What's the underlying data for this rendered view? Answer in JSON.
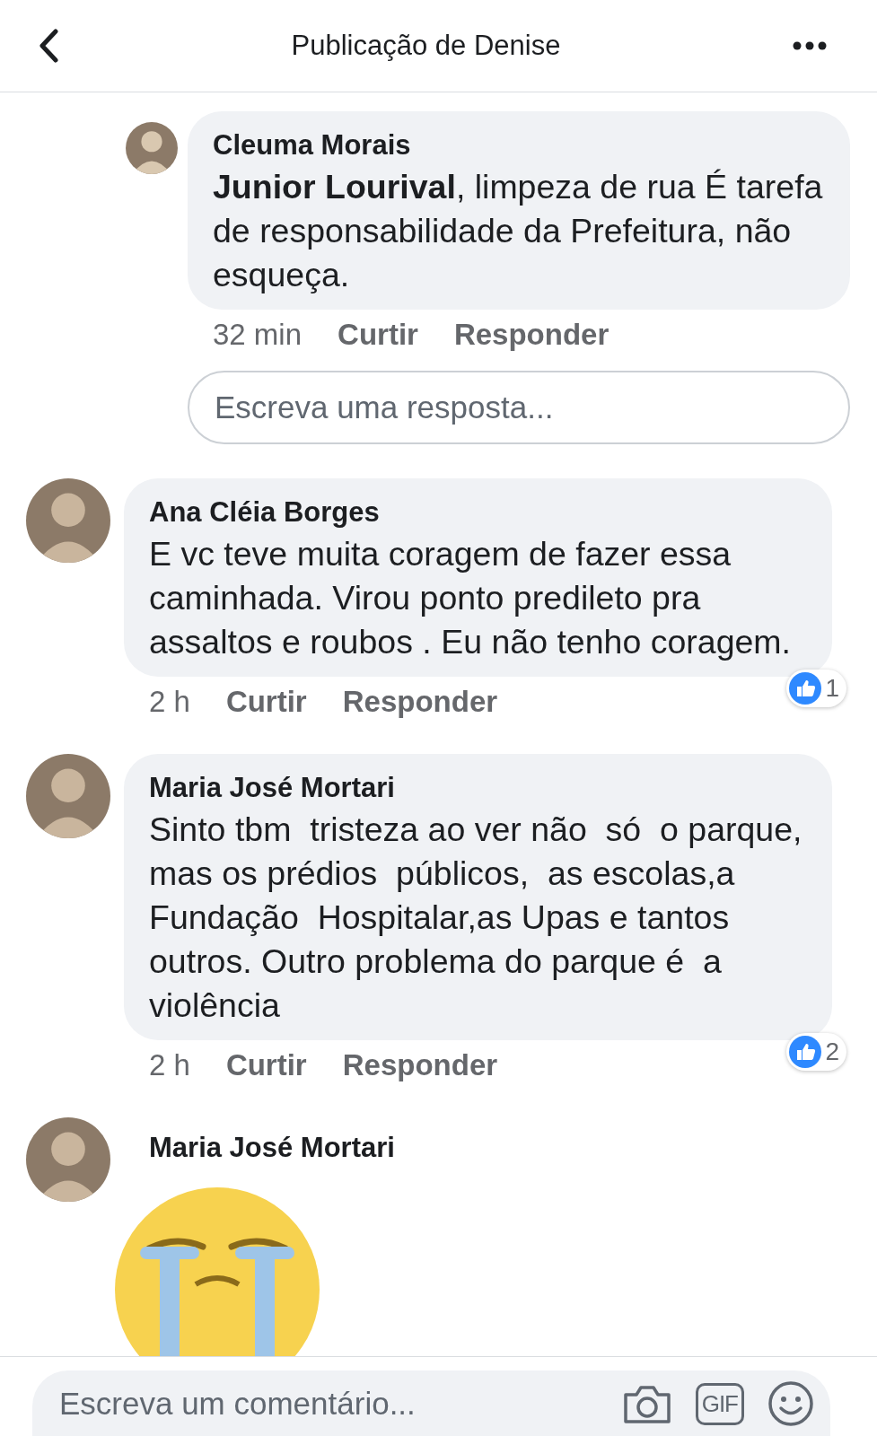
{
  "header": {
    "title": "Publicação de Denise"
  },
  "reply_thread": {
    "replies": [
      {
        "name": "Cleuma Morais",
        "text": "**Junior Lourival**, limpeza de rua É tarefa de responsabilidade da Prefeitura, não esqueça.",
        "time": "32 min",
        "like": "Curtir",
        "reply": "Responder"
      }
    ],
    "reply_field": {
      "placeholder": "Escreva uma resposta..."
    }
  },
  "comments": [
    {
      "kind": "text",
      "name": "Ana Cléia Borges",
      "text": "E vc teve muita coragem de fazer essa caminhada. Virou ponto predileto pra assaltos e roubos . Eu não tenho coragem.",
      "time": "2 h",
      "like": "Curtir",
      "reply": "Responder",
      "reaction_count": "1"
    },
    {
      "kind": "text",
      "name": "Maria José Mortari",
      "text": "Sinto tbm  tristeza ao ver não  só  o parque, mas os prédios  públicos,  as escolas,a Fundação  Hospitalar,as Upas e tantos outros. Outro problema do parque é  a violência",
      "time": "2 h",
      "like": "Curtir",
      "reply": "Responder",
      "reaction_count": "2"
    },
    {
      "kind": "sticker",
      "name": "Maria José Mortari"
    }
  ],
  "composer": {
    "placeholder": "Escreva um comentário...",
    "gif_label": "GIF"
  }
}
